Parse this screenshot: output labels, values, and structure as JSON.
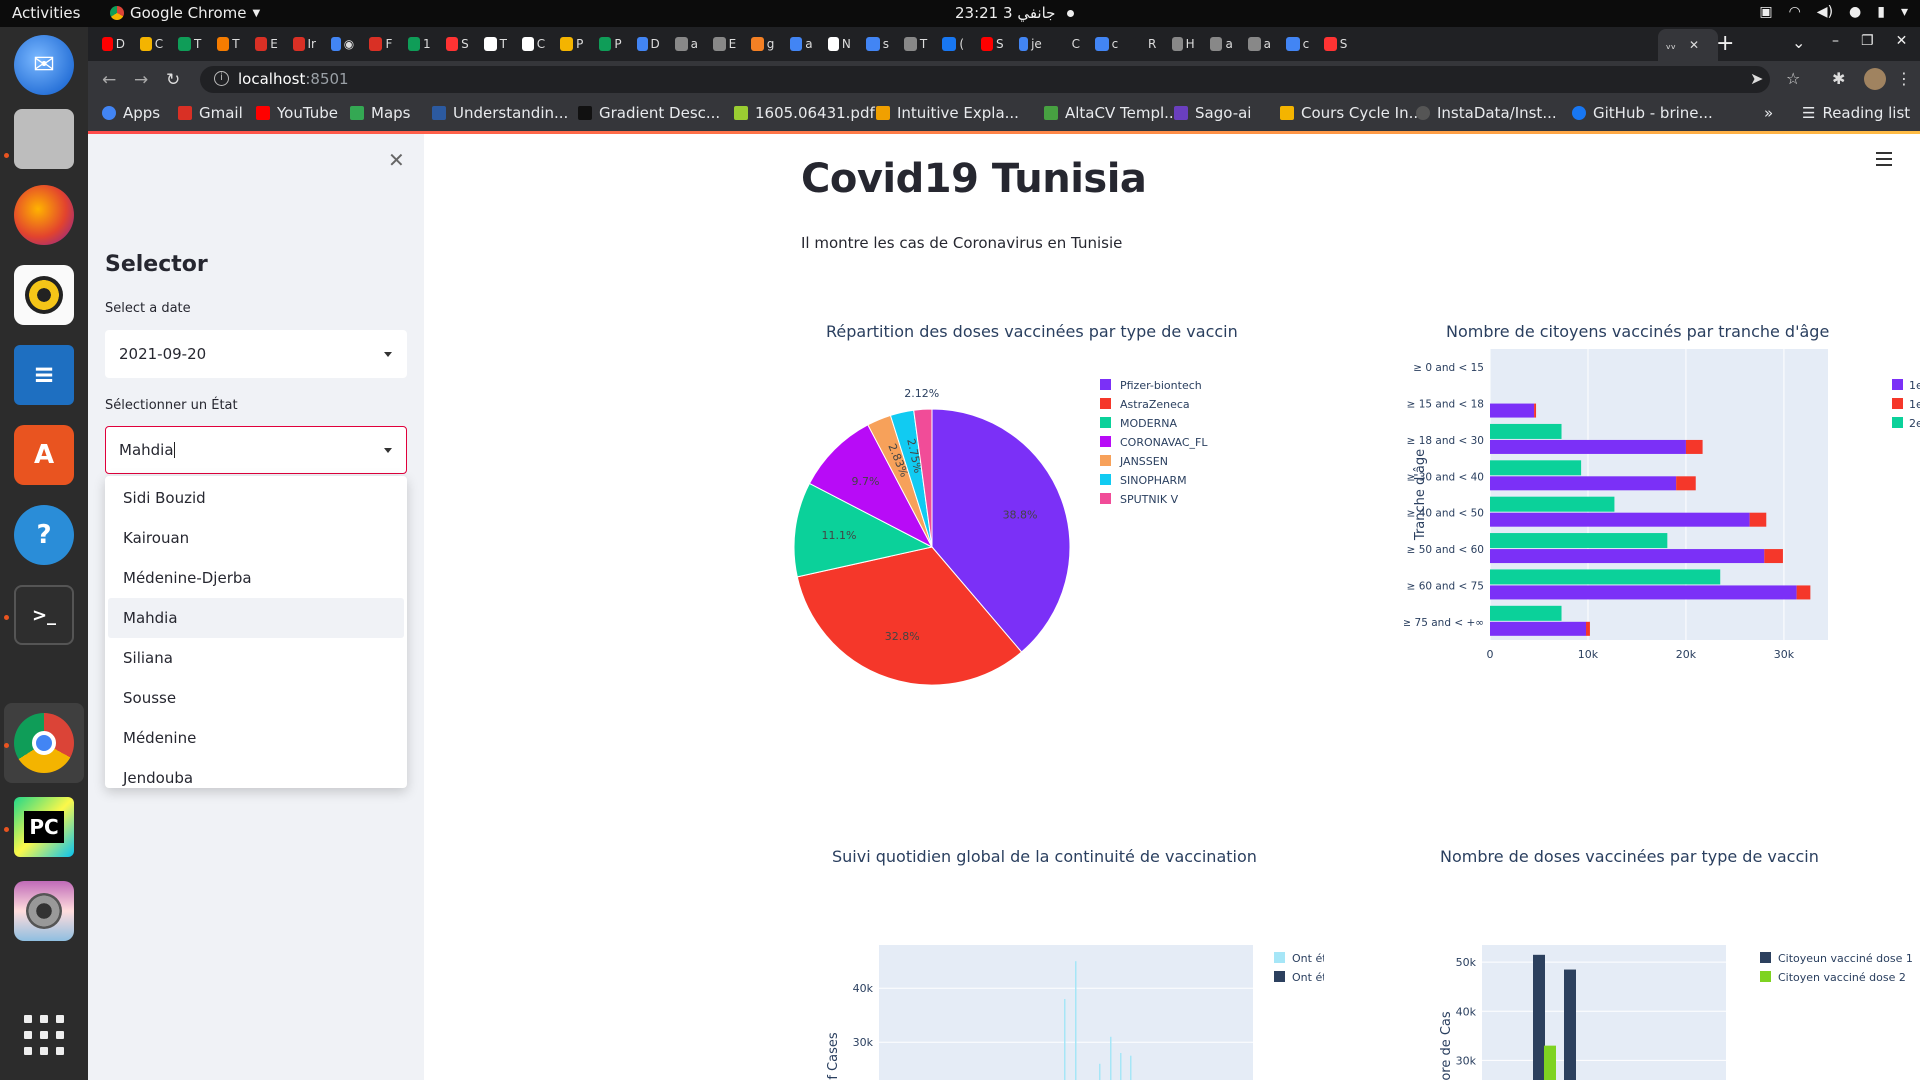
{
  "topbar": {
    "activities": "Activities",
    "app_name": "Google Chrome",
    "clock": "23:21  3 جانفي"
  },
  "browser": {
    "url_host": "localhost",
    "url_port": ":8501",
    "tabs": [
      {
        "letter": "D",
        "color": "#ff0000"
      },
      {
        "letter": "C",
        "color": "#f4b400"
      },
      {
        "letter": "T",
        "color": "#0f9d58"
      },
      {
        "letter": "T",
        "color": "#f57c00"
      },
      {
        "letter": "E",
        "color": "#d93025"
      },
      {
        "letter": "Ir",
        "color": "#d93025"
      },
      {
        "letter": "◉",
        "color": "#4285f4"
      },
      {
        "letter": "F",
        "color": "#d93025"
      },
      {
        "letter": "1",
        "color": "#0f9d58"
      },
      {
        "letter": "S",
        "color": "#ff3333"
      },
      {
        "letter": "T",
        "color": "#ffffff"
      },
      {
        "letter": "C",
        "color": "#ffffff"
      },
      {
        "letter": "P",
        "color": "#f4b400"
      },
      {
        "letter": "P",
        "color": "#0f9d58"
      },
      {
        "letter": "D",
        "color": "#4285f4"
      },
      {
        "letter": "a",
        "color": "#888888"
      },
      {
        "letter": "E",
        "color": "#888888"
      },
      {
        "letter": "g",
        "color": "#f48024"
      },
      {
        "letter": "a",
        "color": "#4285f4"
      },
      {
        "letter": "N",
        "color": "#ffffff"
      },
      {
        "letter": "s",
        "color": "#4285f4"
      },
      {
        "letter": "T",
        "color": "#888888"
      },
      {
        "letter": "(",
        "color": "#1877f2"
      },
      {
        "letter": "S",
        "color": "#ff0000"
      },
      {
        "letter": "je",
        "color": "#4285f4"
      },
      {
        "letter": "C",
        "color": "#202124"
      },
      {
        "letter": "c",
        "color": "#4285f4"
      },
      {
        "letter": "R",
        "color": "#202124"
      },
      {
        "letter": "H",
        "color": "#888888"
      },
      {
        "letter": "a",
        "color": "#888888"
      },
      {
        "letter": "a",
        "color": "#888888"
      },
      {
        "letter": "c",
        "color": "#4285f4"
      },
      {
        "letter": "S",
        "color": "#ff3333"
      }
    ],
    "bookmarks": [
      {
        "label": "Apps",
        "icon": "apps-grid-icon",
        "color": "#4285f4"
      },
      {
        "label": "Gmail",
        "icon": "gmail-icon",
        "color": "#d93025"
      },
      {
        "label": "YouTube",
        "icon": "youtube-icon",
        "color": "#ff0000"
      },
      {
        "label": "Maps",
        "icon": "maps-icon",
        "color": "#34a853"
      },
      {
        "label": "Understandin...",
        "icon": "site-icon",
        "color": "#2c5aa0"
      },
      {
        "label": "Gradient Desc...",
        "icon": "medium-icon",
        "color": "#111111"
      },
      {
        "label": "1605.06431.pdf",
        "icon": "pdf-icon",
        "color": "#9acd32"
      },
      {
        "label": "Intuitive Expla...",
        "icon": "site-icon",
        "color": "#f0a000"
      },
      {
        "label": "AltaCV Templ...",
        "icon": "overleaf-icon",
        "color": "#47a141"
      },
      {
        "label": "Sago-ai",
        "icon": "site-icon",
        "color": "#6a3fbf"
      },
      {
        "label": "Cours Cycle In...",
        "icon": "drive-icon",
        "color": "#f4b400"
      },
      {
        "label": "InstaData/Inst...",
        "icon": "github-icon",
        "color": "#555555"
      },
      {
        "label": "GitHub - brine...",
        "icon": "facebook-icon",
        "color": "#1877f2"
      }
    ],
    "bookmarks_overflow": "»",
    "reading_list": "Reading list"
  },
  "sidebar": {
    "title": "Selector",
    "date_label": "Select a date",
    "date_value": "2021-09-20",
    "state_label": "Sélectionner un État",
    "state_value": "Mahdia",
    "options": [
      "Sidi Bouzid",
      "Kairouan",
      "Médenine-Djerba",
      "Mahdia",
      "Siliana",
      "Sousse",
      "Médenine",
      "Jendouba"
    ],
    "highlighted_option": "Mahdia"
  },
  "main": {
    "title": "Covid19 Tunisia",
    "subtitle": "Il montre les cas de Coronavirus en Tunisie"
  },
  "chart_data": [
    {
      "type": "pie",
      "title": "Répartition des doses vaccinées par type de vaccin",
      "labels": [
        "Pfizer-biontech",
        "AstraZeneca",
        "MODERNA",
        "CORONAVAC_FL",
        "JANSSEN",
        "SINOPHARM",
        "SPUTNIK V"
      ],
      "values": [
        38.8,
        32.8,
        11.1,
        9.7,
        2.83,
        2.75,
        2.12
      ],
      "value_labels": [
        "38.8%",
        "32.8%",
        "11.1%",
        "9.7%",
        "2.83%",
        "2.75%",
        "2.12%"
      ],
      "colors": [
        "#7b30f7",
        "#f5372a",
        "#0bd19a",
        "#b80bf7",
        "#f7a15a",
        "#11cbf2",
        "#f14c98"
      ],
      "legend": "right"
    },
    {
      "type": "bar",
      "orientation": "horizontal",
      "title": "Nombre de citoyens vaccinés par tranche d'âge",
      "ylabel": "Tranche d'âge",
      "categories": [
        "≥ 0 and < 15",
        "≥ 15 and < 18",
        "≥ 18 and < 30",
        "≥ 30 and < 40",
        "≥ 40 and < 50",
        "≥ 50 and < 60",
        "≥ 60 and < 75",
        "≥ 75 and < +∞"
      ],
      "x_ticks": [
        "0",
        "10k",
        "20k",
        "30k"
      ],
      "xlim": [
        0,
        34500
      ],
      "series": [
        {
          "color": "#7b30f7",
          "values": [
            0,
            4500,
            20000,
            19000,
            26500,
            28000,
            31300,
            9800
          ]
        },
        {
          "color": "#f5372a",
          "values": [
            0,
            200,
            1700,
            2000,
            1700,
            1900,
            1400,
            400
          ]
        },
        {
          "color": "#0bd19a",
          "values": [
            0,
            0,
            7300,
            9300,
            12700,
            18100,
            23500,
            7300
          ]
        }
      ],
      "legend_visible_text": [
        "1e",
        "1e",
        "2e"
      ],
      "legend": "right",
      "grid": true
    },
    {
      "type": "bar",
      "title": "Suivi quotidien global de la continuité de vaccination",
      "ylabel": "of Cases",
      "y_ticks": [
        "30k",
        "40k"
      ],
      "series": [
        {
          "name": "Ont été convoqués",
          "color": "#a6e6f7"
        },
        {
          "name": "Ont été vaccinés",
          "color": "#2c405e"
        }
      ],
      "visible_spikes": [
        38000,
        45000,
        26000,
        31000,
        28000,
        27500
      ],
      "legend": "right",
      "grid": true
    },
    {
      "type": "bar",
      "title": "Nombre de doses vaccinées par type de vaccin",
      "ylabel": "ore de Cas",
      "y_ticks": [
        "30k",
        "40k",
        "50k"
      ],
      "series": [
        {
          "name": "Citoyeun vacciné dose 1",
          "color": "#2c405e",
          "values": [
            51500,
            48500
          ]
        },
        {
          "name": "Citoyen vacciné dose 2",
          "color": "#7ed321",
          "values": [
            33000
          ]
        }
      ],
      "legend": "right",
      "grid": true
    }
  ]
}
